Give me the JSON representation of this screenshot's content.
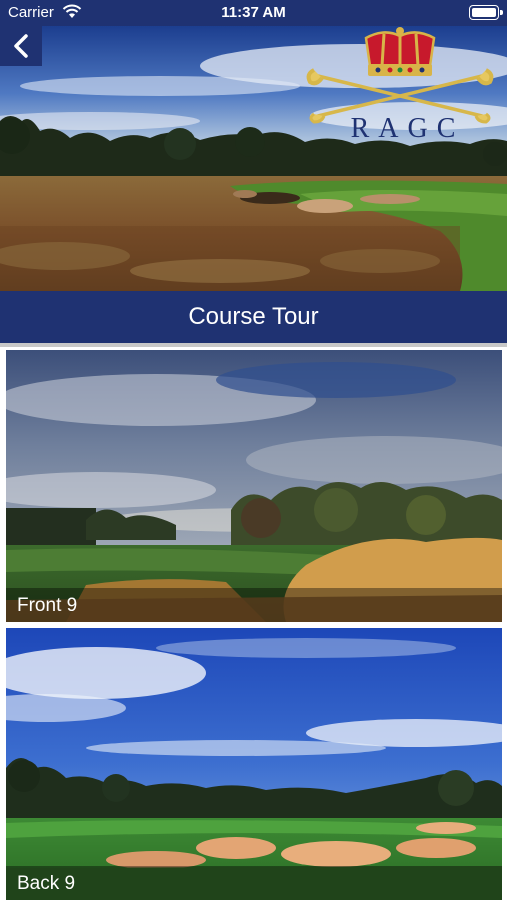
{
  "status_bar": {
    "carrier": "Carrier",
    "time": "11:37 AM",
    "icons": [
      "wifi-icon",
      "battery-icon"
    ]
  },
  "header": {
    "back_icon": "chevron-left-icon",
    "logo_text": "RAGC",
    "logo_icons": [
      "crown-icon",
      "crossed-golf-clubs-icon"
    ]
  },
  "page_title": "Course Tour",
  "tours": [
    {
      "label": "Front 9"
    },
    {
      "label": "Back 9"
    }
  ],
  "colors": {
    "brand_navy": "#1f3272",
    "caption_overlay": "rgba(0,0,0,0.38)",
    "text_light": "#ffffff"
  }
}
